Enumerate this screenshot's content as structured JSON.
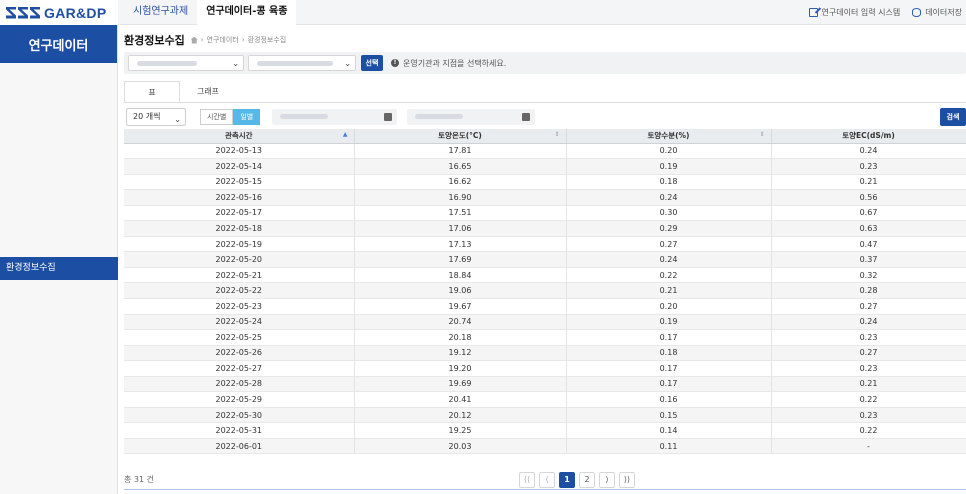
{
  "app": {
    "logo_text": "GAR&DP",
    "nav": [
      "시험연구과제",
      "연구데이터-콩 육종"
    ],
    "links": [
      "연구데이터 입력 시스템",
      "데이터저장"
    ]
  },
  "sidebar": {
    "title": "연구데이터",
    "items": [
      "환경정보수집"
    ]
  },
  "header": {
    "title": "환경정보수집",
    "breadcrumb": [
      "연구데이터",
      "환경정보수집"
    ]
  },
  "filter": {
    "select_button": "선택",
    "notice": "운영기관과 지점을 선택하세요."
  },
  "tabs": [
    "표",
    "그래프"
  ],
  "controls": {
    "per_page": "20 개씩",
    "periods": [
      "시간별",
      "일별"
    ],
    "active_period": "일별",
    "search_button": "검색"
  },
  "table": {
    "columns": [
      "관측시간",
      "토양온도(°C)",
      "토양수분(%)",
      "토양EC(dS/m)"
    ],
    "rows": [
      [
        "2022-05-13",
        "17.81",
        "0.20",
        "0.24"
      ],
      [
        "2022-05-14",
        "16.65",
        "0.19",
        "0.23"
      ],
      [
        "2022-05-15",
        "16.62",
        "0.18",
        "0.21"
      ],
      [
        "2022-05-16",
        "16.90",
        "0.24",
        "0.56"
      ],
      [
        "2022-05-17",
        "17.51",
        "0.30",
        "0.67"
      ],
      [
        "2022-05-18",
        "17.06",
        "0.29",
        "0.63"
      ],
      [
        "2022-05-19",
        "17.13",
        "0.27",
        "0.47"
      ],
      [
        "2022-05-20",
        "17.69",
        "0.24",
        "0.37"
      ],
      [
        "2022-05-21",
        "18.84",
        "0.22",
        "0.32"
      ],
      [
        "2022-05-22",
        "19.06",
        "0.21",
        "0.28"
      ],
      [
        "2022-05-23",
        "19.67",
        "0.20",
        "0.27"
      ],
      [
        "2022-05-24",
        "20.74",
        "0.19",
        "0.24"
      ],
      [
        "2022-05-25",
        "20.18",
        "0.17",
        "0.23"
      ],
      [
        "2022-05-26",
        "19.12",
        "0.18",
        "0.27"
      ],
      [
        "2022-05-27",
        "19.20",
        "0.17",
        "0.23"
      ],
      [
        "2022-05-28",
        "19.69",
        "0.17",
        "0.21"
      ],
      [
        "2022-05-29",
        "20.41",
        "0.16",
        "0.22"
      ],
      [
        "2022-05-30",
        "20.12",
        "0.15",
        "0.23"
      ],
      [
        "2022-05-31",
        "19.25",
        "0.14",
        "0.22"
      ],
      [
        "2022-06-01",
        "20.03",
        "0.11",
        "-"
      ]
    ]
  },
  "footer": {
    "total": "총 31 건",
    "pagination": {
      "first": "⟨⟨",
      "prev": "⟨",
      "pages": [
        "1",
        "2"
      ],
      "current": "1",
      "next": "⟩",
      "last": "⟩⟩"
    }
  },
  "colors": {
    "primary": "#1c4ea3",
    "accent": "#55b8e6"
  }
}
